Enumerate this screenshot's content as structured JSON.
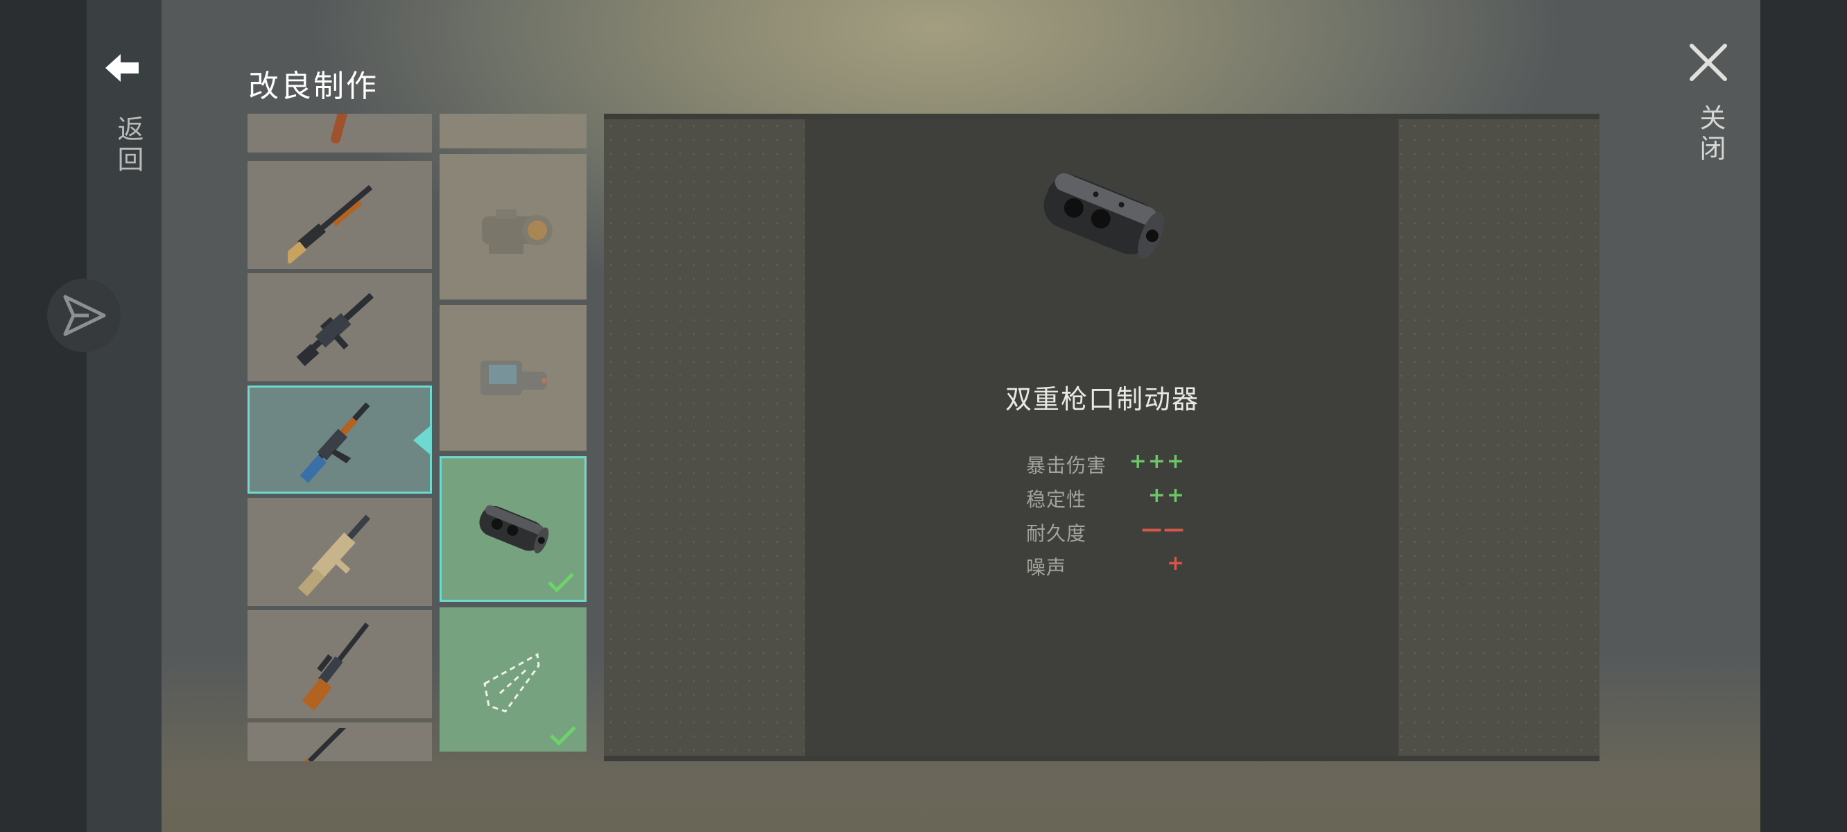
{
  "header": {
    "title": "改良制作"
  },
  "nav": {
    "back_label": "返回",
    "close_label": "关闭"
  },
  "weapons": [
    {
      "name": "weapon-top-partial",
      "icon": "rifle-icon"
    },
    {
      "name": "pump-shotgun",
      "icon": "shotgun-icon"
    },
    {
      "name": "m4-rifle",
      "icon": "assault-rifle-icon"
    },
    {
      "name": "ak-rifle",
      "icon": "ak-rifle-icon",
      "selected": true
    },
    {
      "name": "scar-rifle",
      "icon": "tan-rifle-icon"
    },
    {
      "name": "svd-rifle",
      "icon": "sniper-rifle-icon"
    },
    {
      "name": "weapon-bottom-partial",
      "icon": "rifle-icon"
    }
  ],
  "mods": [
    {
      "name": "mod-top-partial",
      "icon": "empty-slot"
    },
    {
      "name": "red-dot-sight",
      "icon": "red-dot-sight-icon",
      "available": false
    },
    {
      "name": "holographic-sight",
      "icon": "holo-sight-icon",
      "available": false
    },
    {
      "name": "dual-muzzle-brake",
      "icon": "muzzle-brake-icon",
      "available": true,
      "selected": true,
      "checked": true
    },
    {
      "name": "stock-outline",
      "icon": "stock-outline-icon",
      "available": true,
      "checked": true
    }
  ],
  "detail": {
    "item_name": "双重枪口制动器",
    "stats": [
      {
        "label": "暴击伤害",
        "value": "+++",
        "type": "positive"
      },
      {
        "label": "稳定性",
        "value": "++",
        "type": "positive"
      },
      {
        "label": "耐久度",
        "value": "——",
        "type": "negative"
      },
      {
        "label": "噪声",
        "value": "+",
        "type": "negative"
      }
    ]
  },
  "colors": {
    "accent": "#6ed9d0",
    "positive": "#6ec46a",
    "negative": "#d4584a",
    "mod_available": "#76a27f"
  }
}
